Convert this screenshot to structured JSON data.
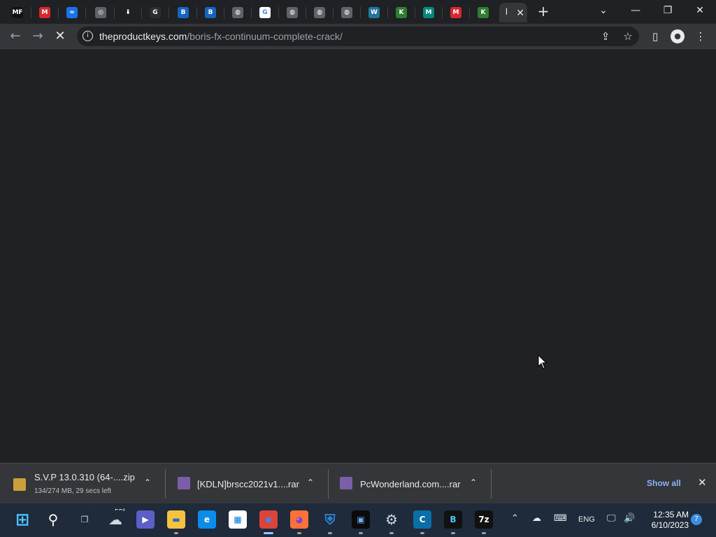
{
  "tabs": [
    {
      "id": "mf",
      "glyph": "MF",
      "color": "#111111",
      "icon": "mf-favicon-icon"
    },
    {
      "id": "mega1",
      "glyph": "M",
      "color": "#d9272e",
      "icon": "mega-favicon-icon"
    },
    {
      "id": "blue1",
      "glyph": "≈",
      "color": "#1a73e8",
      "icon": "wave-favicon-icon"
    },
    {
      "id": "chrome",
      "glyph": "◎",
      "color": "#5f6368",
      "icon": "chrome-favicon-icon"
    },
    {
      "id": "download",
      "glyph": "⬇",
      "color": "#202124",
      "icon": "download-favicon-icon"
    },
    {
      "id": "g1",
      "glyph": "G",
      "color": "#2d2d2d",
      "icon": "g-favicon-icon"
    },
    {
      "id": "b1",
      "glyph": "B",
      "color": "#1565c0",
      "icon": "b-shield-favicon-icon"
    },
    {
      "id": "b2",
      "glyph": "B",
      "color": "#1565c0",
      "icon": "b-shield-favicon-icon"
    },
    {
      "id": "globe1",
      "glyph": "◍",
      "color": "#5f6368",
      "icon": "globe-favicon-icon"
    },
    {
      "id": "google",
      "glyph": "G",
      "color": "#ffffff",
      "icon": "google-favicon-icon"
    },
    {
      "id": "globe2",
      "glyph": "◍",
      "color": "#5f6368",
      "icon": "globe-favicon-icon"
    },
    {
      "id": "globe3",
      "glyph": "◍",
      "color": "#5f6368",
      "icon": "globe-favicon-icon"
    },
    {
      "id": "globe4",
      "glyph": "◍",
      "color": "#5f6368",
      "icon": "globe-favicon-icon"
    },
    {
      "id": "wp",
      "glyph": "W",
      "color": "#21759b",
      "icon": "wordpress-favicon-icon"
    },
    {
      "id": "k1",
      "glyph": "K",
      "color": "#2e7d32",
      "icon": "k-favicon-icon"
    },
    {
      "id": "m1",
      "glyph": "M",
      "color": "#00897b",
      "icon": "m-favicon-icon"
    },
    {
      "id": "mega2",
      "glyph": "M",
      "color": "#d9272e",
      "icon": "mega-favicon-icon"
    },
    {
      "id": "k2",
      "glyph": "K",
      "color": "#2e7d32",
      "icon": "k-favicon-icon"
    }
  ],
  "active_tab": {
    "glyph": "l",
    "close": "✕"
  },
  "new_tab": "+",
  "window_controls": {
    "dropdown": "⌄",
    "minimize": "—",
    "maximize": "❐",
    "close": "✕"
  },
  "toolbar": {
    "back": "←",
    "forward": "→",
    "stop": "✕",
    "url_host": "theproductkeys.com",
    "url_path": "/boris-fx-continuum-complete-crack/",
    "share": "⇪",
    "bookmark": "☆",
    "sidepanel": "▯",
    "profile": "●",
    "menu": "⋮"
  },
  "downloads": [
    {
      "name": "S.V.P 13.0.310 (64-....zip",
      "status": "134/274 MB, 29 secs left",
      "progress_percent": 49,
      "icon_color": "#c8a13a"
    },
    {
      "name": "[KDLN]brscc2021v1....rar",
      "status": "",
      "icon_color": "#7b5ea7"
    },
    {
      "name": "PcWonderland.com....rar",
      "status": "",
      "icon_color": "#7b5ea7"
    }
  ],
  "shelf": {
    "show_all": "Show all",
    "close": "✕",
    "chevron": "⌃"
  },
  "taskbar": {
    "apps": [
      {
        "id": "start",
        "glyph": "⊞",
        "color": "#1f2a3a",
        "fg": "#4cc2ff",
        "icon": "windows-start-icon"
      },
      {
        "id": "search",
        "glyph": "⚲",
        "color": "#1f2a3a",
        "fg": "#ffffff",
        "icon": "search-icon"
      },
      {
        "id": "taskview",
        "glyph": "❐",
        "color": "#1f2a3a",
        "fg": "#cfd8dc",
        "icon": "task-view-icon"
      },
      {
        "id": "weather",
        "glyph": "☁",
        "color": "#1f2a3a",
        "fg": "#cfd8dc",
        "icon": "weather-icon"
      },
      {
        "id": "meet",
        "glyph": "▶",
        "color": "#5b5fc7",
        "fg": "#ffffff",
        "icon": "teams-chat-icon"
      },
      {
        "id": "explorer",
        "glyph": "▬",
        "color": "#f5c242",
        "fg": "#1f6fb8",
        "icon": "file-explorer-icon"
      },
      {
        "id": "edge",
        "glyph": "e",
        "color": "#0c8ce9",
        "fg": "#ffffff",
        "icon": "edge-icon"
      },
      {
        "id": "store",
        "glyph": "▦",
        "color": "#ffffff",
        "fg": "#0078d4",
        "icon": "store-icon"
      },
      {
        "id": "chrome",
        "glyph": "◉",
        "color": "#db4437",
        "fg": "#4285f4",
        "icon": "chrome-icon"
      },
      {
        "id": "firefox",
        "glyph": "◕",
        "color": "#ff7139",
        "fg": "#7542e5",
        "icon": "firefox-icon"
      },
      {
        "id": "defender",
        "glyph": "⛨",
        "color": "#1f2a3a",
        "fg": "#2b88d8",
        "icon": "defender-shield-icon"
      },
      {
        "id": "media",
        "glyph": "▣",
        "color": "#0b0b0b",
        "fg": "#6ab0ff",
        "icon": "media-player-icon"
      },
      {
        "id": "settings",
        "glyph": "⚙",
        "color": "#1f2a3a",
        "fg": "#cfd8dc",
        "icon": "settings-gear-icon"
      },
      {
        "id": "c",
        "glyph": "C",
        "color": "#0a6ea8",
        "fg": "#ffffff",
        "icon": "c-app-icon"
      },
      {
        "id": "b",
        "glyph": "B",
        "color": "#111111",
        "fg": "#4cc2ff",
        "icon": "b-app-icon"
      },
      {
        "id": "7z",
        "glyph": "7z",
        "color": "#111111",
        "fg": "#ffffff",
        "icon": "7zip-icon"
      }
    ],
    "weather_temp": "52°",
    "tray": {
      "chevron": "⌃",
      "cloud": "☁",
      "keyboard": "⌨",
      "language": "ENG",
      "network": "🖵",
      "volume": "🔊"
    },
    "time": "12:35 AM",
    "date": "6/10/2023",
    "notifications": "7"
  }
}
